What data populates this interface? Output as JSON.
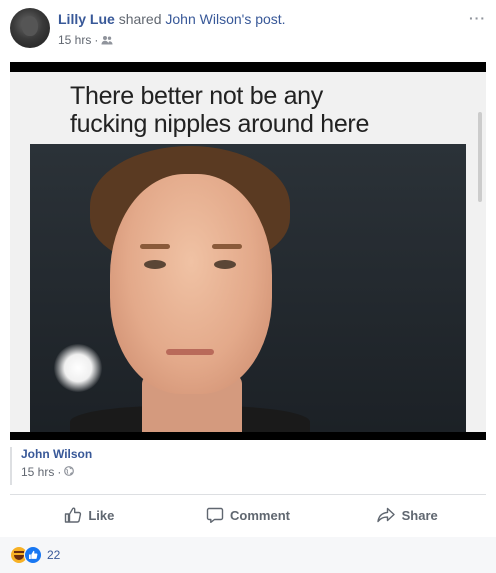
{
  "header": {
    "author": "Lilly Lue",
    "shared_text": "shared",
    "original_author": "John Wilson",
    "possessive": "'s post.",
    "time": "15 hrs",
    "sep": "·",
    "more": "···"
  },
  "meme": {
    "caption_line1": "There better not be any",
    "caption_line2": "fucking nipples around here"
  },
  "attribution": {
    "name": "John Wilson",
    "time": "15 hrs",
    "sep": "·"
  },
  "actions": {
    "like": "Like",
    "comment": "Comment",
    "share": "Share"
  },
  "reactions": {
    "count": "22"
  }
}
